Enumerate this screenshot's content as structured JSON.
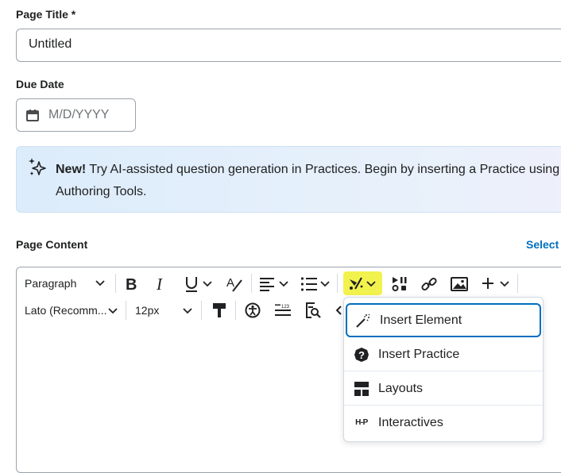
{
  "form": {
    "title_label": "Page Title",
    "required_mark": " *",
    "title_value": "Untitled",
    "due_label": "Due Date",
    "due_placeholder": "M/D/YYYY"
  },
  "banner": {
    "new_label": "New!",
    "line1": " Try AI-assisted question generation in Practices. Begin by inserting a Practice using",
    "line2": "Authoring Tools."
  },
  "content": {
    "label": "Page Content",
    "select_link": "Select"
  },
  "toolbar": {
    "paragraph": "Paragraph",
    "font": "Lato (Recomm...",
    "size": "12px"
  },
  "insert_menu": {
    "items": [
      {
        "label": "Insert Element",
        "icon": "magic-wand-icon"
      },
      {
        "label": "Insert Practice",
        "icon": "question-circle-icon"
      },
      {
        "label": "Layouts",
        "icon": "layout-icon"
      },
      {
        "label": "Interactives",
        "icon": "h5p-icon",
        "icon_text": "H-P"
      }
    ]
  },
  "colors": {
    "accent": "#006fbf",
    "highlight": "#f2f24e",
    "banner_bg": "#dcecfb"
  }
}
